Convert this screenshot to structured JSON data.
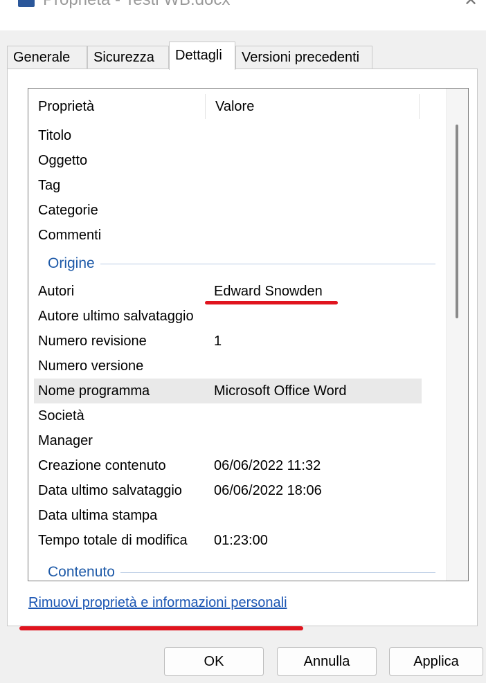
{
  "window": {
    "title": "Proprietà - Testi WB.docx",
    "icon": "word-document-icon",
    "close_icon": "close-icon"
  },
  "tabs": [
    {
      "label": "Generale"
    },
    {
      "label": "Sicurezza"
    },
    {
      "label": "Dettagli",
      "active": true
    },
    {
      "label": "Versioni precedenti"
    }
  ],
  "list": {
    "columns": [
      "Proprietà",
      "Valore"
    ],
    "rows_top": [
      {
        "name": "Titolo",
        "value": ""
      },
      {
        "name": "Oggetto",
        "value": ""
      },
      {
        "name": "Tag",
        "value": ""
      },
      {
        "name": "Categorie",
        "value": ""
      },
      {
        "name": "Commenti",
        "value": ""
      }
    ],
    "group_origin": "Origine",
    "rows_origin": [
      {
        "name": "Autori",
        "value": "Edward Snowden"
      },
      {
        "name": "Autore ultimo salvataggio",
        "value": ""
      },
      {
        "name": "Numero revisione",
        "value": "1"
      },
      {
        "name": "Numero versione",
        "value": ""
      },
      {
        "name": "Nome programma",
        "value": "Microsoft Office Word",
        "selected": true
      },
      {
        "name": "Società",
        "value": ""
      },
      {
        "name": "Manager",
        "value": ""
      },
      {
        "name": "Creazione contenuto",
        "value": "06/06/2022 11:32"
      },
      {
        "name": "Data ultimo salvataggio",
        "value": "06/06/2022 18:06"
      },
      {
        "name": "Data ultima stampa",
        "value": ""
      },
      {
        "name": "Tempo totale di modifica",
        "value": "01:23:00"
      }
    ],
    "group_content": "Contenuto"
  },
  "link": {
    "label": "Rimuovi proprietà e informazioni personali"
  },
  "buttons": {
    "ok": "OK",
    "cancel": "Annulla",
    "apply": "Applica"
  },
  "colors": {
    "annotation": "#e0141e",
    "link": "#1a55b3",
    "group": "#1e5aa8"
  }
}
